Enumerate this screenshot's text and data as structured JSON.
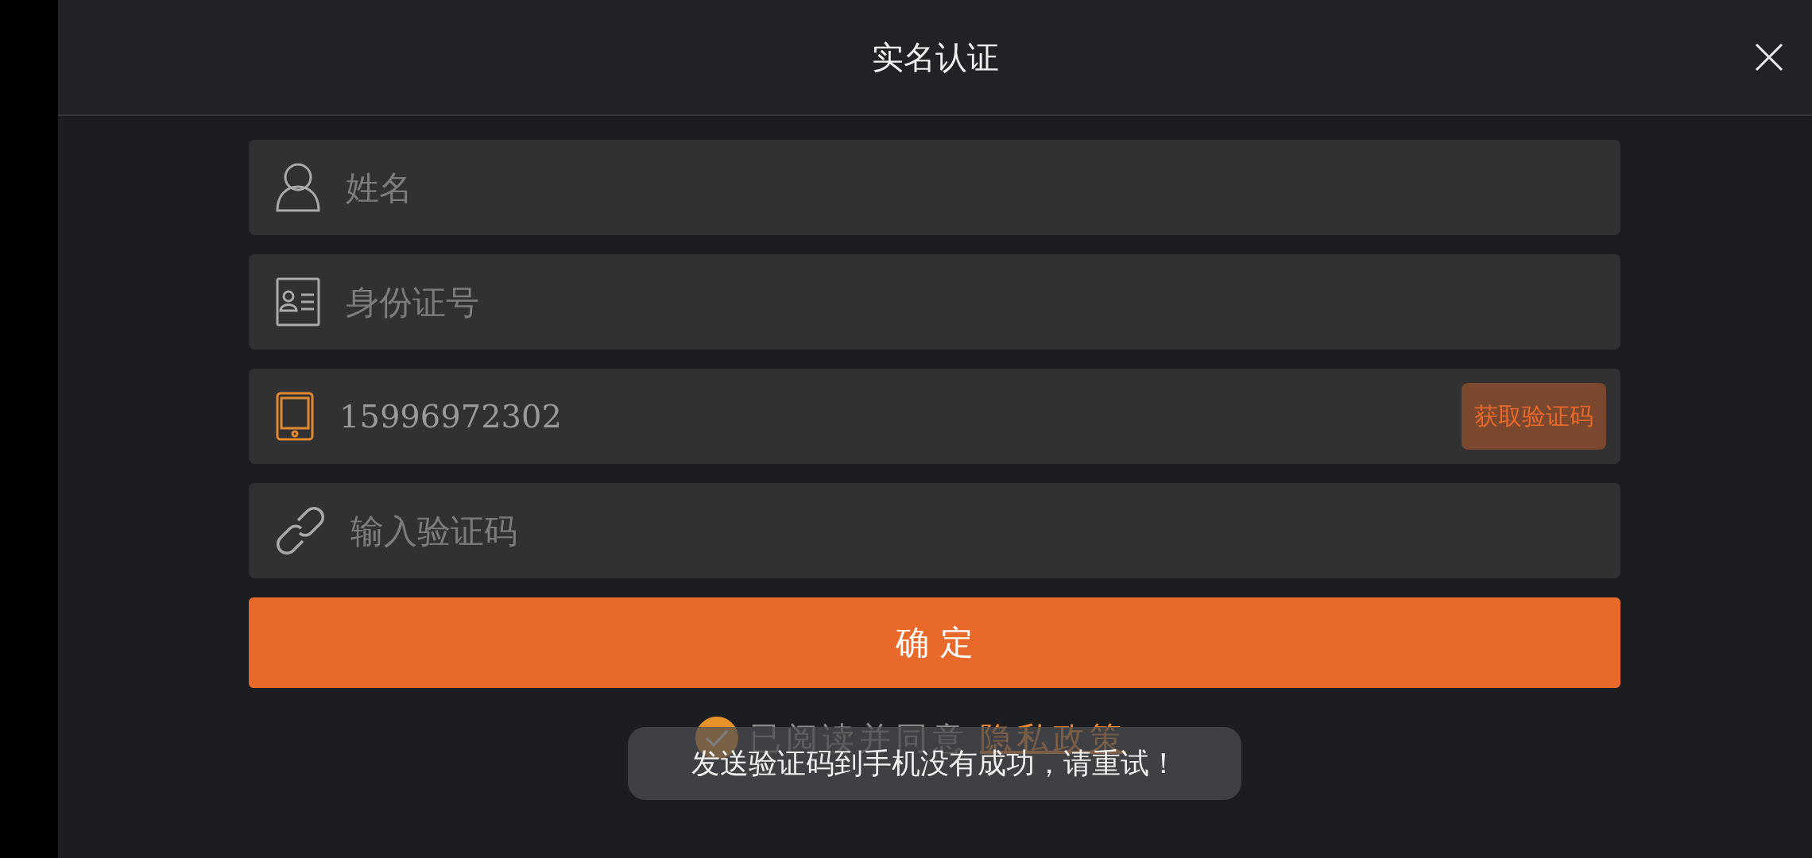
{
  "dialog": {
    "title": "实名认证"
  },
  "fields": [
    {
      "kind": "name",
      "placeholder": "姓名",
      "focused": false
    },
    {
      "kind": "id",
      "placeholder": "身份证号",
      "focused": false
    },
    {
      "kind": "phone",
      "value": "15996972302",
      "focused": true,
      "action": "获取验证码"
    },
    {
      "kind": "code",
      "placeholder": "输入验证码",
      "focused": false
    }
  ],
  "confirm_button": "确 定",
  "agreement": {
    "checked": true,
    "text": "已阅读并同意",
    "link": "隐私政策"
  },
  "toast": "发送验证码到手机没有成功，请重试！"
}
